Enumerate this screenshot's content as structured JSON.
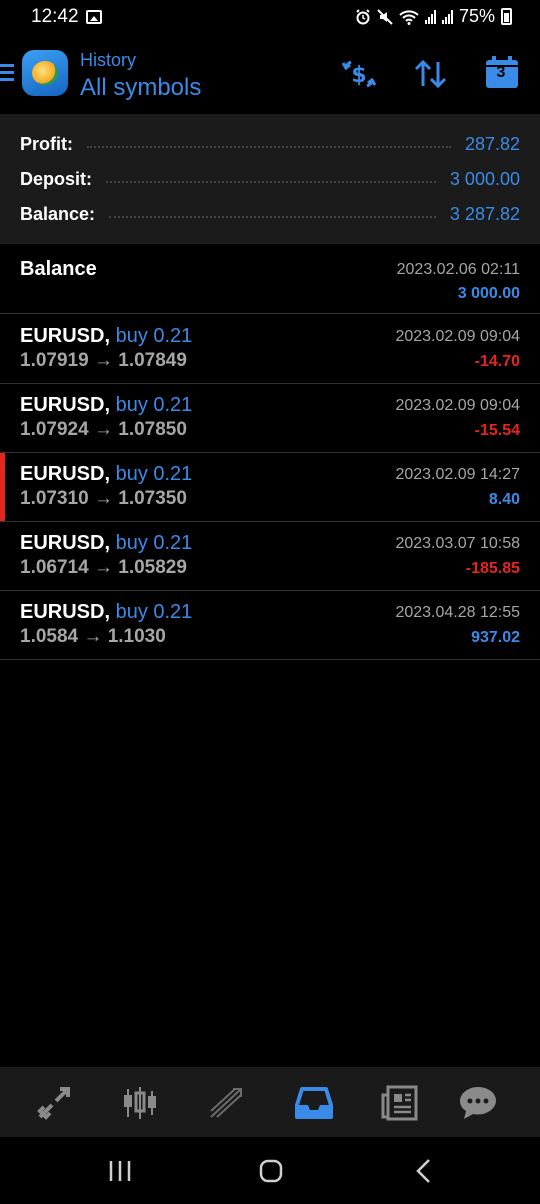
{
  "status": {
    "time": "12:42",
    "battery": "75%"
  },
  "header": {
    "subtitle": "History",
    "title": "All symbols",
    "calendar_day": "3"
  },
  "summary": [
    {
      "label": "Profit:",
      "value": "287.82"
    },
    {
      "label": "Deposit:",
      "value": "3 000.00"
    },
    {
      "label": "Balance:",
      "value": "3 287.82"
    }
  ],
  "balance_entry": {
    "title": "Balance",
    "time": "2023.02.06 02:11",
    "amount": "3 000.00"
  },
  "deals": [
    {
      "symbol": "EURUSD,",
      "side": "buy 0.21",
      "open": "1.07919",
      "close": "1.07849",
      "time": "2023.02.09 09:04",
      "profit": "-14.70",
      "profit_sign": "negative",
      "selected": false
    },
    {
      "symbol": "EURUSD,",
      "side": "buy 0.21",
      "open": "1.07924",
      "close": "1.07850",
      "time": "2023.02.09 09:04",
      "profit": "-15.54",
      "profit_sign": "negative",
      "selected": false
    },
    {
      "symbol": "EURUSD,",
      "side": "buy 0.21",
      "open": "1.07310",
      "close": "1.07350",
      "time": "2023.02.09 14:27",
      "profit": "8.40",
      "profit_sign": "positive",
      "selected": true
    },
    {
      "symbol": "EURUSD,",
      "side": "buy 0.21",
      "open": "1.06714",
      "close": "1.05829",
      "time": "2023.03.07 10:58",
      "profit": "-185.85",
      "profit_sign": "negative",
      "selected": false
    },
    {
      "symbol": "EURUSD,",
      "side": "buy 0.21",
      "open": "1.0584",
      "close": "1.1030",
      "time": "2023.04.28 12:55",
      "profit": "937.02",
      "profit_sign": "positive",
      "selected": false
    }
  ],
  "arrow": "→",
  "tabs": [
    {
      "icon": "quotes-icon",
      "active": false
    },
    {
      "icon": "chart-icon",
      "active": false
    },
    {
      "icon": "trade-icon",
      "active": false
    },
    {
      "icon": "history-icon",
      "active": true
    },
    {
      "icon": "news-icon",
      "active": false
    },
    {
      "icon": "chat-icon",
      "active": false
    }
  ],
  "colors": {
    "accent": "#3a8be8",
    "negative": "#e52520",
    "muted": "#a6a6a6",
    "background": "#000000",
    "panel": "#1b1b1b"
  }
}
